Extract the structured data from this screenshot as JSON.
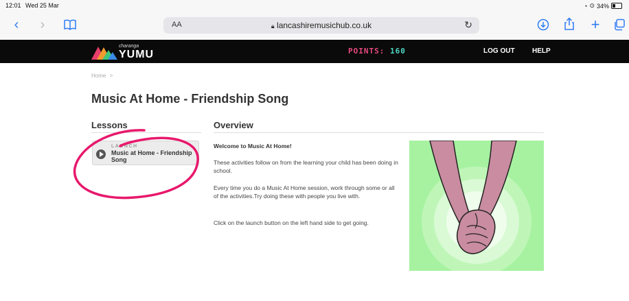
{
  "status": {
    "time": "12:01",
    "date": "Wed 25 Mar",
    "battery": "34%"
  },
  "browser": {
    "back_icon": "chevron-left-icon",
    "forward_icon": "chevron-right-icon",
    "text_size_label": "AA",
    "url": "lancashiremusichub.co.uk"
  },
  "site": {
    "brand_sub": "charanga",
    "brand": "YUMU",
    "points_label": "POINTS:",
    "points_value": "160",
    "logout_label": "LOG OUT",
    "help_label": "HELP"
  },
  "breadcrumb": {
    "home": "Home",
    "separator": ">"
  },
  "page": {
    "title": "Music At Home - Friendship Song"
  },
  "lessons": {
    "heading": "Lessons",
    "items": [
      {
        "tag": "LAUNCH",
        "name": "Music at Home - Friendship Song"
      }
    ]
  },
  "overview": {
    "heading": "Overview",
    "intro": "Welcome to Music At Home!",
    "p1": "These activities follow on from the learning your child has been doing in school.",
    "p2": "Every time you do a Music At Home session, work through some or all of the activities.Try doing these with people you live with.",
    "p3": "Click on the launch button on the left hand side to get going."
  },
  "colors": {
    "accent": "#2f7cf6",
    "annotation": "#e8186c",
    "art_background": "#a6f2a0",
    "skin": "#c98ca0"
  }
}
